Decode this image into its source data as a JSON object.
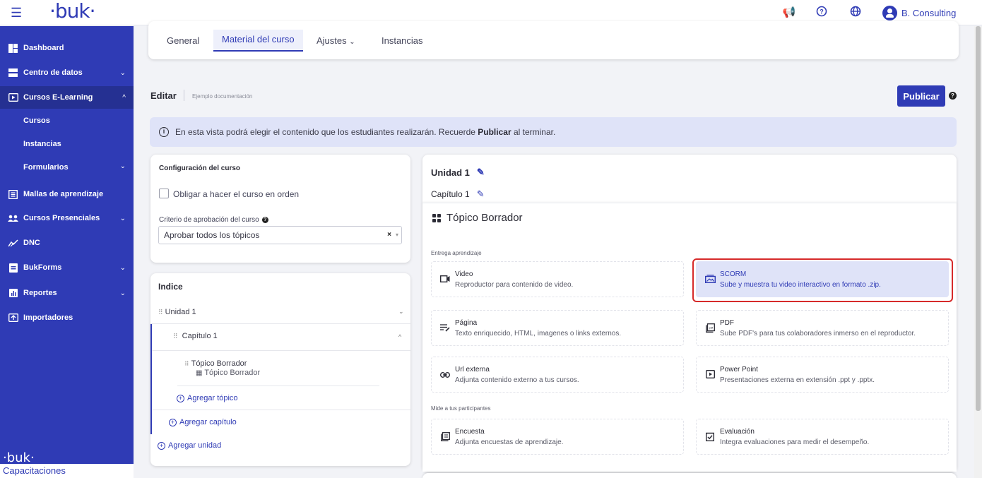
{
  "topbar": {
    "logo": "·buk·",
    "user_name": "B. Consulting",
    "icons": [
      "menu-icon",
      "megaphone-icon",
      "help-icon",
      "globe-icon",
      "user-icon"
    ]
  },
  "sidebar": {
    "items": [
      {
        "label": "Dashboard",
        "icon": "dashboard-icon"
      },
      {
        "label": "Centro de datos",
        "icon": "database-icon"
      },
      {
        "label": "Cursos E-Learning",
        "icon": "play-icon"
      },
      {
        "label": "Mallas de aprendizaje",
        "icon": "book-icon"
      },
      {
        "label": "Cursos Presenciales",
        "icon": "people-icon"
      },
      {
        "label": "DNC",
        "icon": "chart-icon"
      },
      {
        "label": "BukForms",
        "icon": "form-icon"
      },
      {
        "label": "Reportes",
        "icon": "report-icon"
      },
      {
        "label": "Importadores",
        "icon": "import-icon"
      }
    ],
    "subitems": [
      "Cursos",
      "Instancias",
      "Formularios"
    ],
    "footer_logo": "·buk·",
    "footer_label": "Capacitaciones"
  },
  "tabs": [
    "General",
    "Material del curso",
    "Ajustes",
    "Instancias"
  ],
  "header": {
    "title": "Editar",
    "subtitle": "Ejemplo documentación",
    "publish_label": "Publicar"
  },
  "banner": {
    "text_before": "En esta vista podrá elegir el contenido que los estudiantes realizarán. Recuerde ",
    "text_bold": "Publicar",
    "text_after": " al terminar."
  },
  "config": {
    "title": "Configuración del curso",
    "checkbox_label": "Obligar a hacer el curso en orden",
    "criteria_label": "Criterio de aprobación del curso",
    "criteria_value": "Aprobar todos los tópicos"
  },
  "indice": {
    "title": "Indice",
    "unit": "Unidad 1",
    "chapter": "Capítulo 1",
    "topic": "Tópico Borrador",
    "topic_sub": "Tópico Borrador",
    "add_topic": "Agregar tópico",
    "add_chapter": "Agregar capítulo",
    "add_unit": "Agregar unidad"
  },
  "editor": {
    "unit_title": "Unidad 1",
    "chapter_title": "Capítulo 1",
    "topic_title": "Tópico Borrador",
    "section1": "Entrega aprendizaje",
    "section2": "Mide a tus participantes",
    "options": [
      {
        "title": "Video",
        "desc": "Reproductor para contenido de video.",
        "icon": "video-icon"
      },
      {
        "title": "SCORM",
        "desc": "Sube y muestra tu video interactivo en formato .zip.",
        "icon": "image-stack-icon",
        "selected": true
      },
      {
        "title": "Página",
        "desc": "Texto enriquecido, HTML, imagenes o links externos.",
        "icon": "text-edit-icon"
      },
      {
        "title": "PDF",
        "desc": "Sube PDF's para tus colaboradores inmerso en el reproductor.",
        "icon": "pdf-icon"
      },
      {
        "title": "Url externa",
        "desc": "Adjunta contenido externo a tus cursos.",
        "icon": "link-icon"
      },
      {
        "title": "Power Point",
        "desc": "Presentaciones externa en extensión .ppt y .pptx.",
        "icon": "presentation-icon"
      },
      {
        "title": "Encuesta",
        "desc": "Adjunta encuestas de aprendizaje.",
        "icon": "survey-icon"
      },
      {
        "title": "Evaluación",
        "desc": "Integra evaluaciones para medir el desempeño.",
        "icon": "evaluation-icon"
      }
    ]
  },
  "colors": {
    "brand": "#2f3bb5",
    "highlight": "#d62a2a",
    "selected_bg": "#dfe3f8"
  }
}
